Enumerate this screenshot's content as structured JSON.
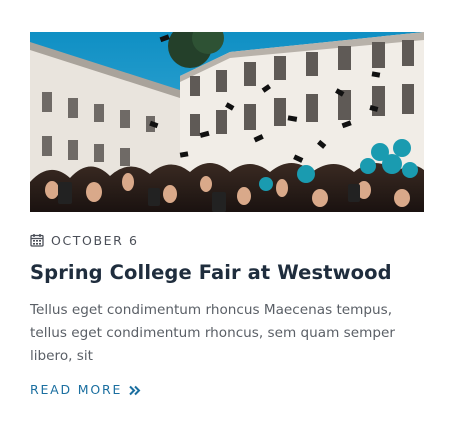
{
  "post": {
    "date": "OCTOBER 6",
    "title": "Spring College Fair at Westwood",
    "excerpt": "Tellus eget condimentum rhoncus Maecenas tempus, tellus eget condimentum rhoncus, sem quam semper libero, sit",
    "read_more": "READ MORE",
    "image_icon": "graduation-photo",
    "date_icon": "calendar-icon",
    "read_more_icon": "double-chevron-right-icon"
  },
  "colors": {
    "title": "#1f2d3d",
    "text": "#5a5f66",
    "meta": "#4b4f58",
    "accent": "#1b6fa0"
  }
}
